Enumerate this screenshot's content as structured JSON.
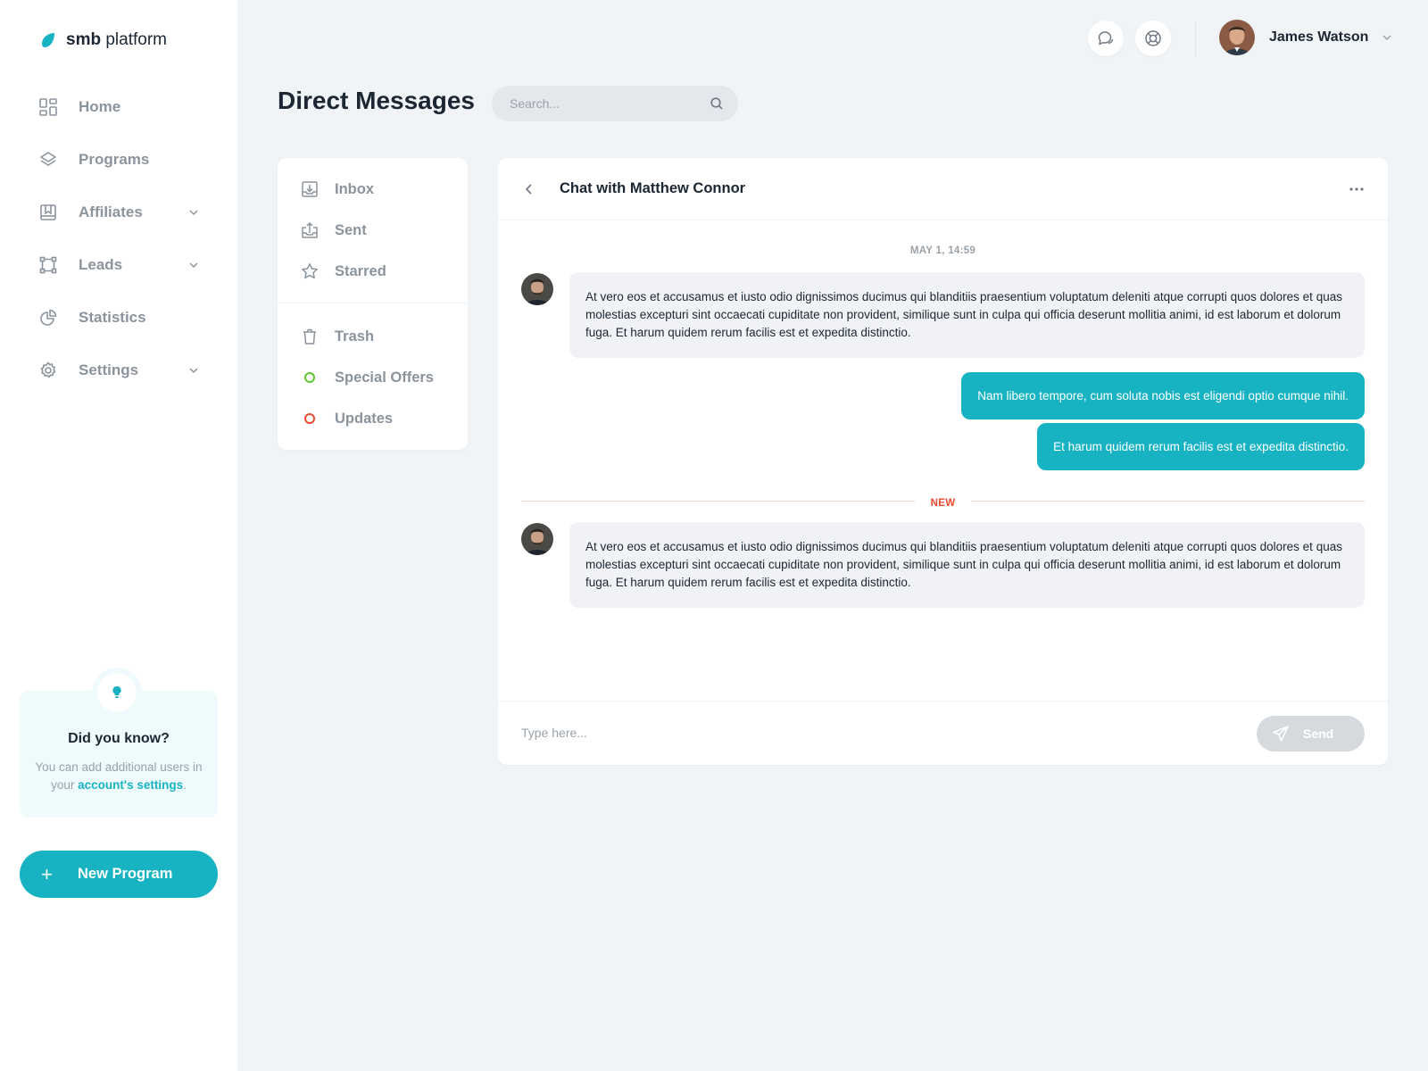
{
  "brand": {
    "name_strong": "smb",
    "name_rest": "platform"
  },
  "sidebar": {
    "items": [
      {
        "label": "Home",
        "icon": "grid-icon",
        "has_chevron": false
      },
      {
        "label": "Programs",
        "icon": "layers-icon",
        "has_chevron": false
      },
      {
        "label": "Affiliates",
        "icon": "affiliates-icon",
        "has_chevron": true
      },
      {
        "label": "Leads",
        "icon": "leads-icon",
        "has_chevron": true
      },
      {
        "label": "Statistics",
        "icon": "pie-chart-icon",
        "has_chevron": false
      },
      {
        "label": "Settings",
        "icon": "gear-icon",
        "has_chevron": true
      }
    ],
    "tip": {
      "icon": "lightbulb-icon",
      "title": "Did you know?",
      "text_before": "You can add additional users in your",
      "link_text": "account's settings",
      "text_after": "."
    },
    "new_program_label": "New Program"
  },
  "topbar": {
    "user_name": "James Watson"
  },
  "page": {
    "title": "Direct Messages",
    "search_placeholder": "Search..."
  },
  "folders": [
    {
      "label": "Inbox",
      "icon": "inbox-icon"
    },
    {
      "label": "Sent",
      "icon": "sent-icon"
    },
    {
      "label": "Starred",
      "icon": "star-icon"
    },
    {
      "label": "Trash",
      "icon": "trash-icon"
    },
    {
      "label": "Special Offers",
      "icon": "dot-icon",
      "color": "#5ec830"
    },
    {
      "label": "Updates",
      "icon": "dot-icon",
      "color": "#ea4b2c"
    }
  ],
  "chat": {
    "title": "Chat with Matthew Connor",
    "date_label": "MAY 1, 14:59",
    "messages_before_new": [
      {
        "direction": "in",
        "text": "At vero eos et accusamus et iusto odio dignissimos ducimus qui blanditiis praesentium voluptatum deleniti atque corrupti quos dolores et quas molestias excepturi sint occaecati cupiditate non provident, similique sunt in culpa qui officia deserunt mollitia animi, id est laborum et dolorum fuga. Et harum quidem rerum facilis est et expedita distinctio."
      },
      {
        "direction": "out",
        "text": "Nam libero tempore, cum soluta nobis est eligendi optio cumque nihil."
      },
      {
        "direction": "out",
        "text": "Et harum quidem rerum facilis est et expedita distinctio."
      }
    ],
    "new_label": "NEW",
    "messages_after_new": [
      {
        "direction": "in",
        "text": "At vero eos et accusamus et iusto odio dignissimos ducimus qui blanditiis praesentium voluptatum deleniti atque corrupti quos dolores et quas molestias excepturi sint occaecati cupiditate non provident, similique sunt in culpa qui officia deserunt mollitia animi, id est laborum et dolorum fuga. Et harum quidem rerum facilis est et expedita distinctio."
      }
    ],
    "composer_placeholder": "Type here...",
    "send_label": "Send"
  },
  "colors": {
    "accent": "#17b3c2",
    "background": "#f0f4f7",
    "muted_text": "#8b939c",
    "new_marker": "#ea4b2c",
    "special_offers": "#5ec830"
  }
}
